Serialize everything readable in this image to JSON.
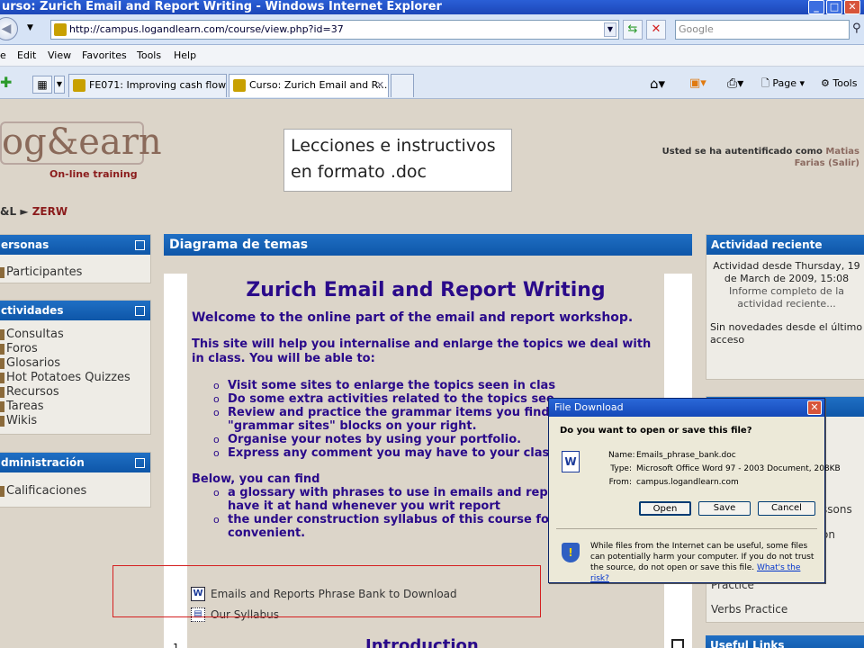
{
  "window": {
    "title": "urso: Zurich Email and Report Writing - Windows Internet Explorer"
  },
  "address_bar": {
    "url": "http://campus.logandlearn.com/course/view.php?id=37",
    "search_placeholder": "Google"
  },
  "menu": [
    "e",
    "Edit",
    "View",
    "Favorites",
    "Tools",
    "Help"
  ],
  "tabs": [
    {
      "label": "FE071: Improving cash flow"
    },
    {
      "label": "Curso: Zurich Email and R..."
    }
  ],
  "command_bar": {
    "page_label": "Page",
    "tools_label": "Tools"
  },
  "header": {
    "logo_main": "og&earn",
    "logo_tagline": "On-line training",
    "callout": "Lecciones e instructivos en formato  .doc",
    "auth_prefix": "Usted se ha autentificado como",
    "auth_user": "Matias Farias",
    "auth_logout": "(Salir)"
  },
  "breadcrumb": {
    "parent": "&L",
    "sep": "►",
    "current": "ZERW"
  },
  "left_blocks": {
    "personas": {
      "title": "ersonas",
      "items": [
        "Participantes"
      ]
    },
    "actividades": {
      "title": "ctividades",
      "items": [
        "Consultas",
        "Foros",
        "Glosarios",
        "Hot Potatoes Quizzes",
        "Recursos",
        "Tareas",
        "Wikis"
      ]
    },
    "admin": {
      "title": "dministración",
      "items": [
        "Calificaciones"
      ]
    }
  },
  "main": {
    "header": "Diagrama de temas",
    "title": "Zurich Email and Report Writing",
    "welcome": "Welcome to the online part of the email and report workshop.",
    "intro": "This site will help you internalise and enlarge the topics we deal with in class. You will be able to:",
    "bullets": [
      "Visit some sites to enlarge the topics seen in clas",
      "Do some extra activities related to the topics see",
      "Review and practice the grammar items you find using the \"grammar sites\" blocks on your right.",
      "Organise your notes by using your portfolio.",
      "Express any comment you may have to your clas teacher."
    ],
    "below": "Below, you can find",
    "bullets2": [
      "a glossary with phrases to use in emails and repo download and have it at hand whenever you writ report",
      "the under construction syllabus of this course for you think convenient."
    ],
    "resources": [
      "Emails and Reports Phrase Bank to Download",
      "Our Syllabus"
    ],
    "section_number": "1",
    "section_title": "Introduction"
  },
  "right_blocks": {
    "recent": {
      "title": "Actividad reciente",
      "since": "Actividad desde Thursday, 19 de March de 2009, 15:08",
      "full_report": "Informe completo de la actividad reciente...",
      "none": "Sin novedades desde el último acceso"
    },
    "partial_items": [
      "ssons",
      "on",
      "Practice",
      "Verbs Practice"
    ],
    "useful_title": "Useful Links"
  },
  "dialog": {
    "title": "File Download",
    "question": "Do you want to open or save this file?",
    "name_label": "Name:",
    "name_value": "Emails_phrase_bank.doc",
    "type_label": "Type:",
    "type_value": "Microsoft Office Word 97 - 2003 Document, 208KB",
    "from_label": "From:",
    "from_value": "campus.logandlearn.com",
    "open_label": "Open",
    "save_label": "Save",
    "cancel_label": "Cancel",
    "note": "While files from the Internet can be useful, some files can potentially harm your computer. If you do not trust the source, do not open or save this file.",
    "risk_link": "What's the risk?"
  },
  "colors": {
    "block_header": "#0e56a8",
    "content_text": "#2a0a8a",
    "highlight_box": "#d42020"
  }
}
